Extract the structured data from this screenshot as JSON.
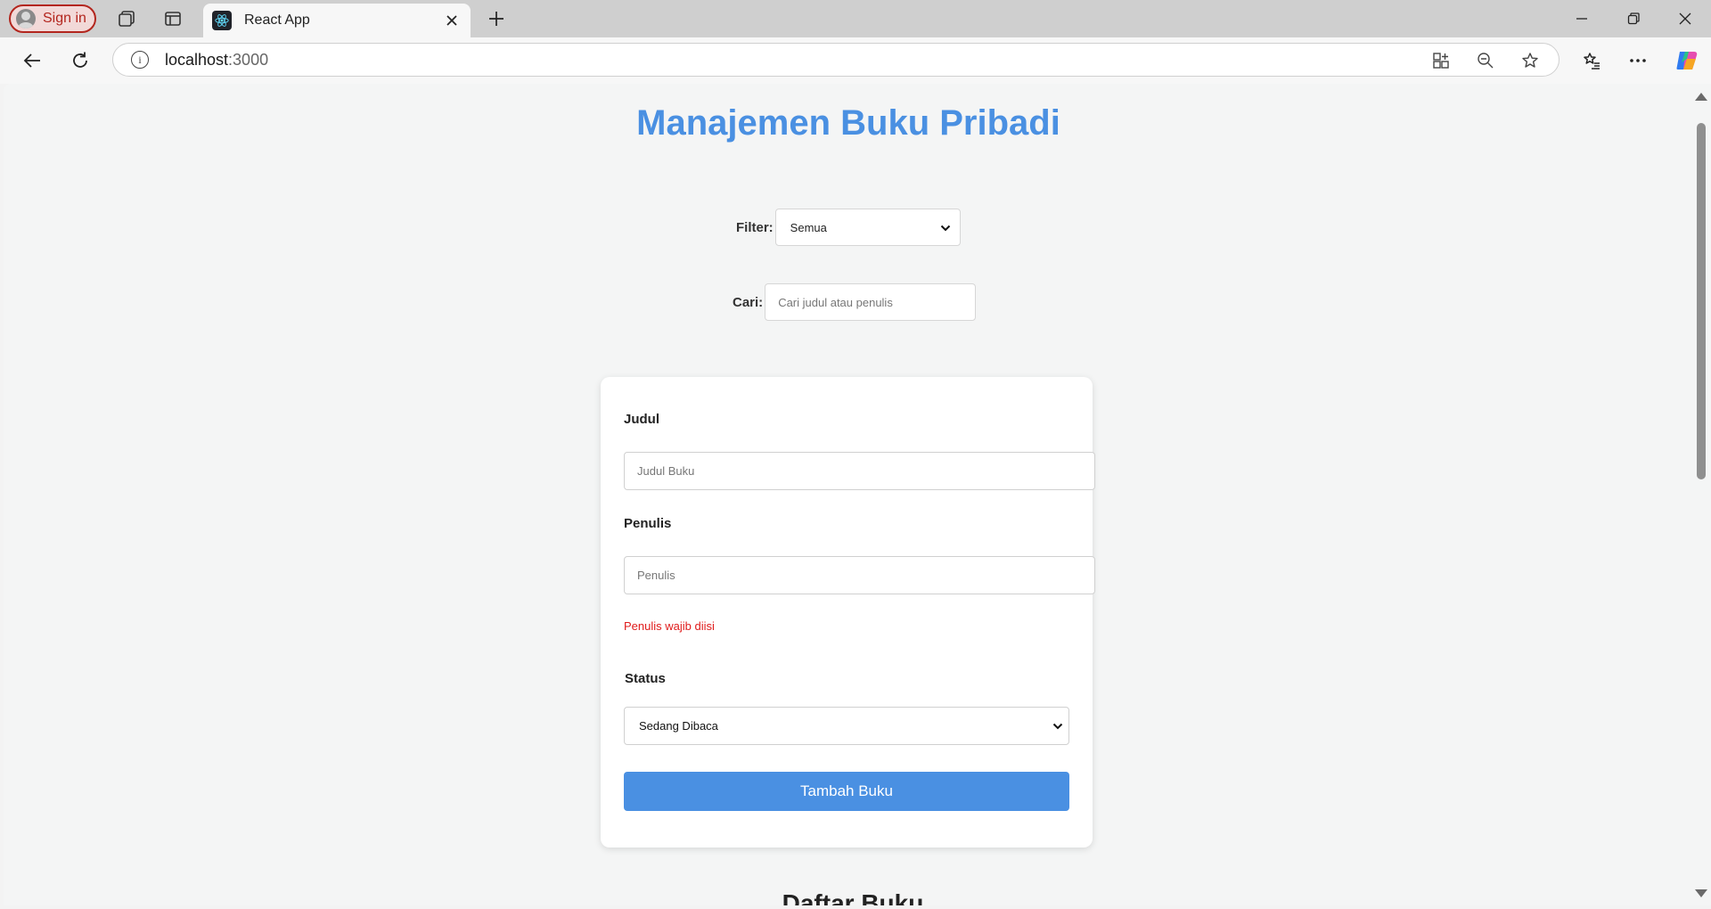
{
  "browser": {
    "signin_label": "Sign in",
    "tab_title": "React App",
    "address_host": "localhost",
    "address_port": ":3000"
  },
  "page": {
    "title": "Manajemen Buku Pribadi",
    "filter": {
      "label": "Filter:",
      "selected": "Semua"
    },
    "search": {
      "label": "Cari:",
      "placeholder": "Cari judul atau penulis"
    },
    "form": {
      "judul_label": "Judul",
      "judul_placeholder": "Judul Buku",
      "penulis_label": "Penulis",
      "penulis_placeholder": "Penulis",
      "error_message": "Penulis wajib diisi",
      "status_label": "Status",
      "status_selected": "Sedang Dibaca",
      "submit_label": "Tambah Buku"
    },
    "list_heading": "Daftar Buku"
  },
  "colors": {
    "accent": "#4a90e2",
    "error": "#e01b1b",
    "signin": "#b3261e"
  }
}
